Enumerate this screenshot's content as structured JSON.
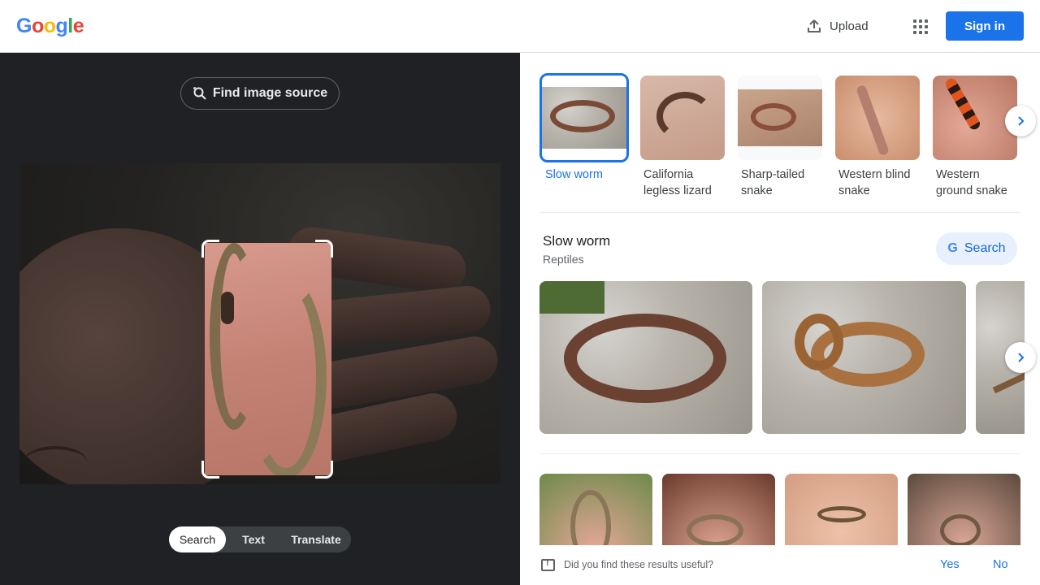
{
  "header": {
    "logo": "Google",
    "upload_label": "Upload",
    "signin_label": "Sign in"
  },
  "left": {
    "find_source_label": "Find image source",
    "modes": [
      "Search",
      "Text",
      "Translate"
    ],
    "active_mode": "Search"
  },
  "related": [
    {
      "label": "Slow worm"
    },
    {
      "label": "California legless lizard"
    },
    {
      "label": "Sharp-tailed snake"
    },
    {
      "label": "Western blind snake"
    },
    {
      "label": "Western ground snake"
    }
  ],
  "section": {
    "title": "Slow worm",
    "subtitle": "Reptiles",
    "search_label": "Search",
    "search_logo": "G"
  },
  "feedback": {
    "question": "Did you find these results useful?",
    "yes": "Yes",
    "no": "No"
  },
  "colors": {
    "accent": "#1a73e8",
    "dark_pane": "#202124",
    "logo_blue": "#4285f4",
    "logo_red": "#ea4335",
    "logo_yellow": "#fbbc05",
    "logo_green": "#34a853"
  },
  "icons": {
    "upload": "upload-icon",
    "apps": "apps-grid-icon",
    "lens": "lens-search-icon",
    "next": "chevron-right-icon",
    "feedback": "feedback-icon"
  }
}
